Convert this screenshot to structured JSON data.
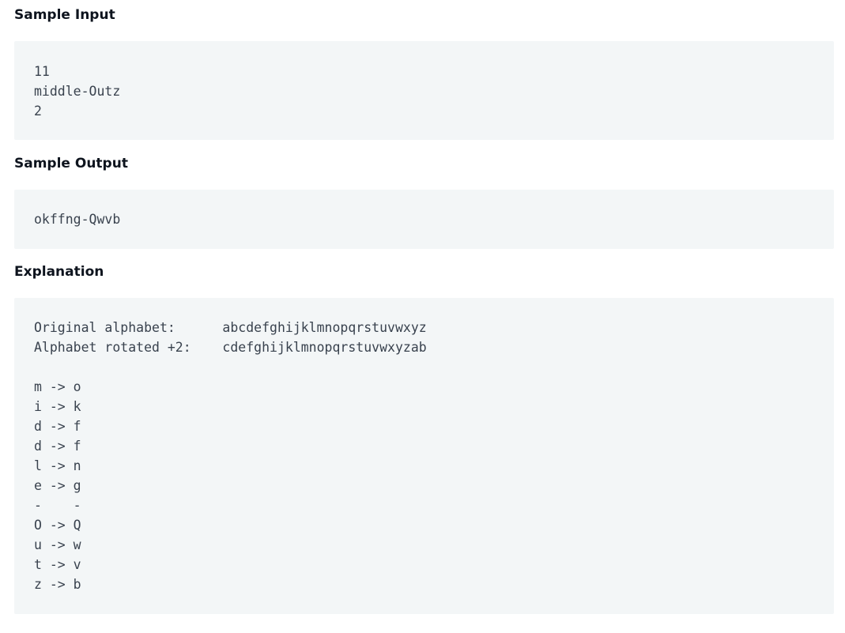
{
  "sample_input": {
    "heading": "Sample Input",
    "lines": [
      "11",
      "middle-Outz",
      "2"
    ]
  },
  "sample_output": {
    "heading": "Sample Output",
    "lines": [
      "okffng-Qwvb"
    ]
  },
  "explanation": {
    "heading": "Explanation",
    "lines": [
      "Original alphabet:      abcdefghijklmnopqrstuvwxyz",
      "Alphabet rotated +2:    cdefghijklmnopqrstuvwxyzab",
      "",
      "m -> o",
      "i -> k",
      "d -> f",
      "d -> f",
      "l -> n",
      "e -> g",
      "-    -",
      "O -> Q",
      "u -> w",
      "t -> v",
      "z -> b"
    ]
  }
}
